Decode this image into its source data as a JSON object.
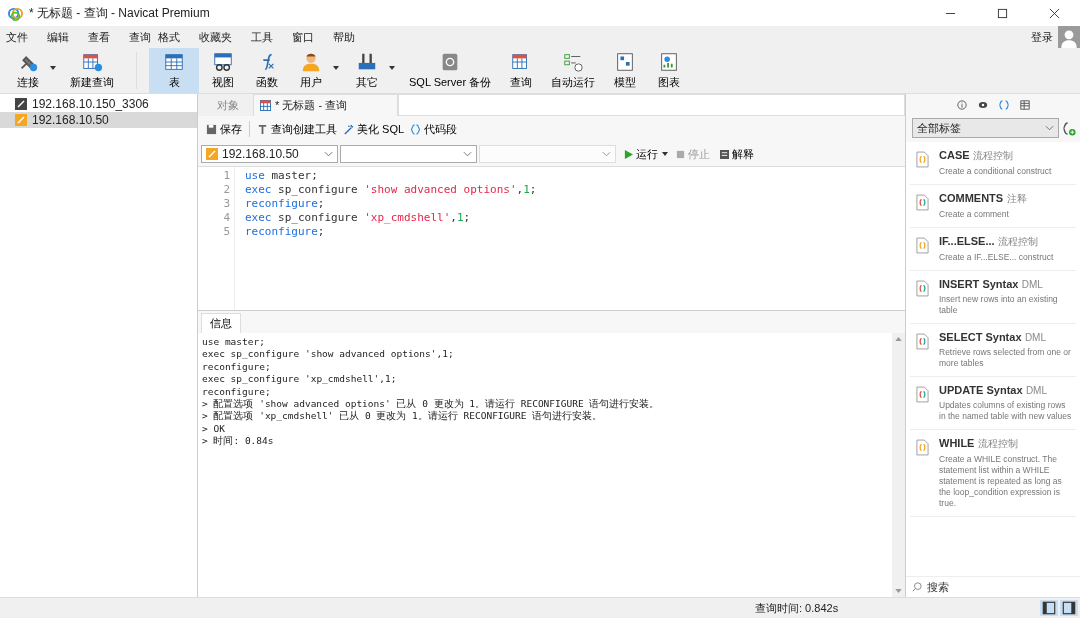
{
  "window": {
    "title": "* 无标题 - 查询 - Navicat Premium"
  },
  "menu": [
    "文件",
    "编辑",
    "查看",
    "查询",
    "格式",
    "收藏夹",
    "工具",
    "窗口",
    "帮助"
  ],
  "login": "登录",
  "toolbar": [
    {
      "label": "连接",
      "dropdown": true,
      "selected": false
    },
    {
      "label": "新建查询",
      "dropdown": false,
      "selected": false
    },
    {
      "label": "表",
      "dropdown": false,
      "selected": true
    },
    {
      "label": "视图",
      "dropdown": false,
      "selected": false
    },
    {
      "label": "函数",
      "dropdown": false,
      "selected": false
    },
    {
      "label": "用户",
      "dropdown": true,
      "selected": false
    },
    {
      "label": "其它",
      "dropdown": true,
      "selected": false
    },
    {
      "label": "SQL Server 备份",
      "dropdown": false,
      "selected": false
    },
    {
      "label": "查询",
      "dropdown": false,
      "selected": false
    },
    {
      "label": "自动运行",
      "dropdown": false,
      "selected": false
    },
    {
      "label": "模型",
      "dropdown": false,
      "selected": false
    },
    {
      "label": "图表",
      "dropdown": false,
      "selected": false
    }
  ],
  "connections": [
    {
      "name": "192.168.10.150_3306",
      "kind": "mysql",
      "selected": false
    },
    {
      "name": "192.168.10.50",
      "kind": "mssql",
      "selected": true
    }
  ],
  "tabs": [
    {
      "label": "对象",
      "selected": false
    },
    {
      "label": "* 无标题 - 查询",
      "selected": true
    }
  ],
  "query_toolbar": [
    "保存",
    "查询创建工具",
    "美化 SQL",
    "代码段"
  ],
  "selectors": [
    {
      "value": "192.168.10.50",
      "disabled": false
    },
    {
      "disabled": false
    },
    {
      "disabled": true
    }
  ],
  "actions": [
    {
      "label": "运行",
      "disabled": false,
      "dropdown": true
    },
    {
      "label": "停止",
      "disabled": true,
      "dropdown": false
    },
    {
      "label": "解释",
      "disabled": false,
      "dropdown": false
    }
  ],
  "editor": {
    "lines": [
      [
        {
          "kind": "keyword",
          "text": "use"
        },
        {
          "kind": "plain",
          "text": " master;"
        }
      ],
      [
        {
          "kind": "keyword",
          "text": "exec"
        },
        {
          "kind": "plain",
          "text": " sp_configure "
        },
        {
          "kind": "string",
          "text": "'show advanced options'"
        },
        {
          "kind": "plain",
          "text": ","
        },
        {
          "kind": "number",
          "text": "1"
        },
        {
          "kind": "plain",
          "text": ";"
        }
      ],
      [
        {
          "kind": "keyword",
          "text": "reconfigure"
        },
        {
          "kind": "plain",
          "text": ";"
        }
      ],
      [
        {
          "kind": "keyword",
          "text": "exec"
        },
        {
          "kind": "plain",
          "text": " sp_configure "
        },
        {
          "kind": "string",
          "text": "'xp_cmdshell'"
        },
        {
          "kind": "plain",
          "text": ","
        },
        {
          "kind": "number",
          "text": "1"
        },
        {
          "kind": "plain",
          "text": ";"
        }
      ],
      [
        {
          "kind": "keyword",
          "text": "reconfigure"
        },
        {
          "kind": "plain",
          "text": ";"
        }
      ]
    ],
    "line_numbers": [
      "1",
      "2",
      "3",
      "4",
      "5"
    ]
  },
  "output": {
    "tab": "信息",
    "lines": [
      "use master;",
      "exec sp_configure 'show advanced options',1;",
      "reconfigure;",
      "exec sp_configure 'xp_cmdshell',1;",
      "reconfigure;",
      "> 配置选项 'show advanced options' 已从 0 更改为 1。请运行 RECONFIGURE 语句进行安装。",
      "> 配置选项 'xp_cmdshell' 已从 0 更改为 1。请运行 RECONFIGURE 语句进行安装。",
      "> OK",
      "> 时间: 0.84s"
    ]
  },
  "snippets_panel": {
    "tabs": [
      {
        "selected": false
      },
      {
        "selected": false
      },
      {
        "selected": true
      },
      {
        "selected": false
      }
    ],
    "filter": "全部标签",
    "items": [
      {
        "title": "CASE",
        "tag": "流程控制",
        "desc": "Create a conditional construct",
        "kind": "flow"
      },
      {
        "title": "COMMENTS",
        "tag": "注释",
        "desc": "Create a comment",
        "kind": "syntax"
      },
      {
        "title": "IF...ELSE...",
        "tag": "流程控制",
        "desc": "Create a IF...ELSE... construct",
        "kind": "flow"
      },
      {
        "title": "INSERT Syntax",
        "tag": "DML",
        "desc": "Insert new rows into an existing table",
        "kind": "syntax"
      },
      {
        "title": "SELECT Syntax",
        "tag": "DML",
        "desc": "Retrieve rows selected from one or more tables",
        "kind": "syntax"
      },
      {
        "title": "UPDATE Syntax",
        "tag": "DML",
        "desc": "Updates columns of existing rows in the named table with new values",
        "kind": "syntax"
      },
      {
        "title": "WHILE",
        "tag": "流程控制",
        "desc": "Create a WHILE construct. The statement list within a WHILE statement is repeated as long as the loop_condition expression is true.",
        "kind": "flow"
      }
    ],
    "search_placeholder": "搜索"
  },
  "status_bar": {
    "query_time": "查询时间: 0.842s",
    "views": [
      {
        "selected": true
      },
      {
        "selected": true
      }
    ]
  }
}
